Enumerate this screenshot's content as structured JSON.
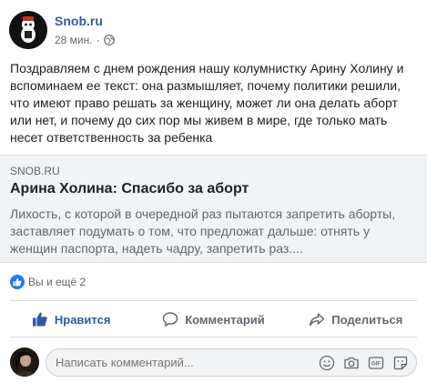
{
  "header": {
    "page_name": "Snob.ru",
    "time": "28 мин.",
    "separator": "·"
  },
  "post": {
    "text": "Поздравляем с днем рождения нашу колумнистку Арину Холину и вспоминаем ее текст: она размышляет, почему политики решили, что имеют право решать за женщину, может ли она делать аборт или нет, и почему до сих пор мы живем в мире, где только мать несет ответственность за ребенка"
  },
  "preview": {
    "domain": "SNOB.RU",
    "title": "Арина Холина: Спасибо за аборт",
    "description": "Лихость, с которой в очередной раз пытаются запретить аборты, заставляет подумать о том, что предложат дальше: отнять у женщин паспорта, надеть чадру, запретить раз...."
  },
  "reactions": {
    "text": "Вы и ещё 2"
  },
  "actions": {
    "like": "Нравится",
    "comment": "Комментарий",
    "share": "Поделиться"
  },
  "composer": {
    "placeholder": "Написать комментарий..."
  },
  "colors": {
    "link": "#385898",
    "like_active": "#2d5ba3",
    "like_badge": "#2078f4",
    "preview_bg": "#f2f3f5"
  },
  "icons": {
    "globe": "globe-icon",
    "like": "thumbs-up-icon",
    "comment": "comment-bubble-icon",
    "share": "share-arrow-icon",
    "emoji": "emoji-icon",
    "camera": "camera-icon",
    "gif": "gif-icon",
    "sticker": "sticker-icon"
  },
  "gif_label": "GIF"
}
